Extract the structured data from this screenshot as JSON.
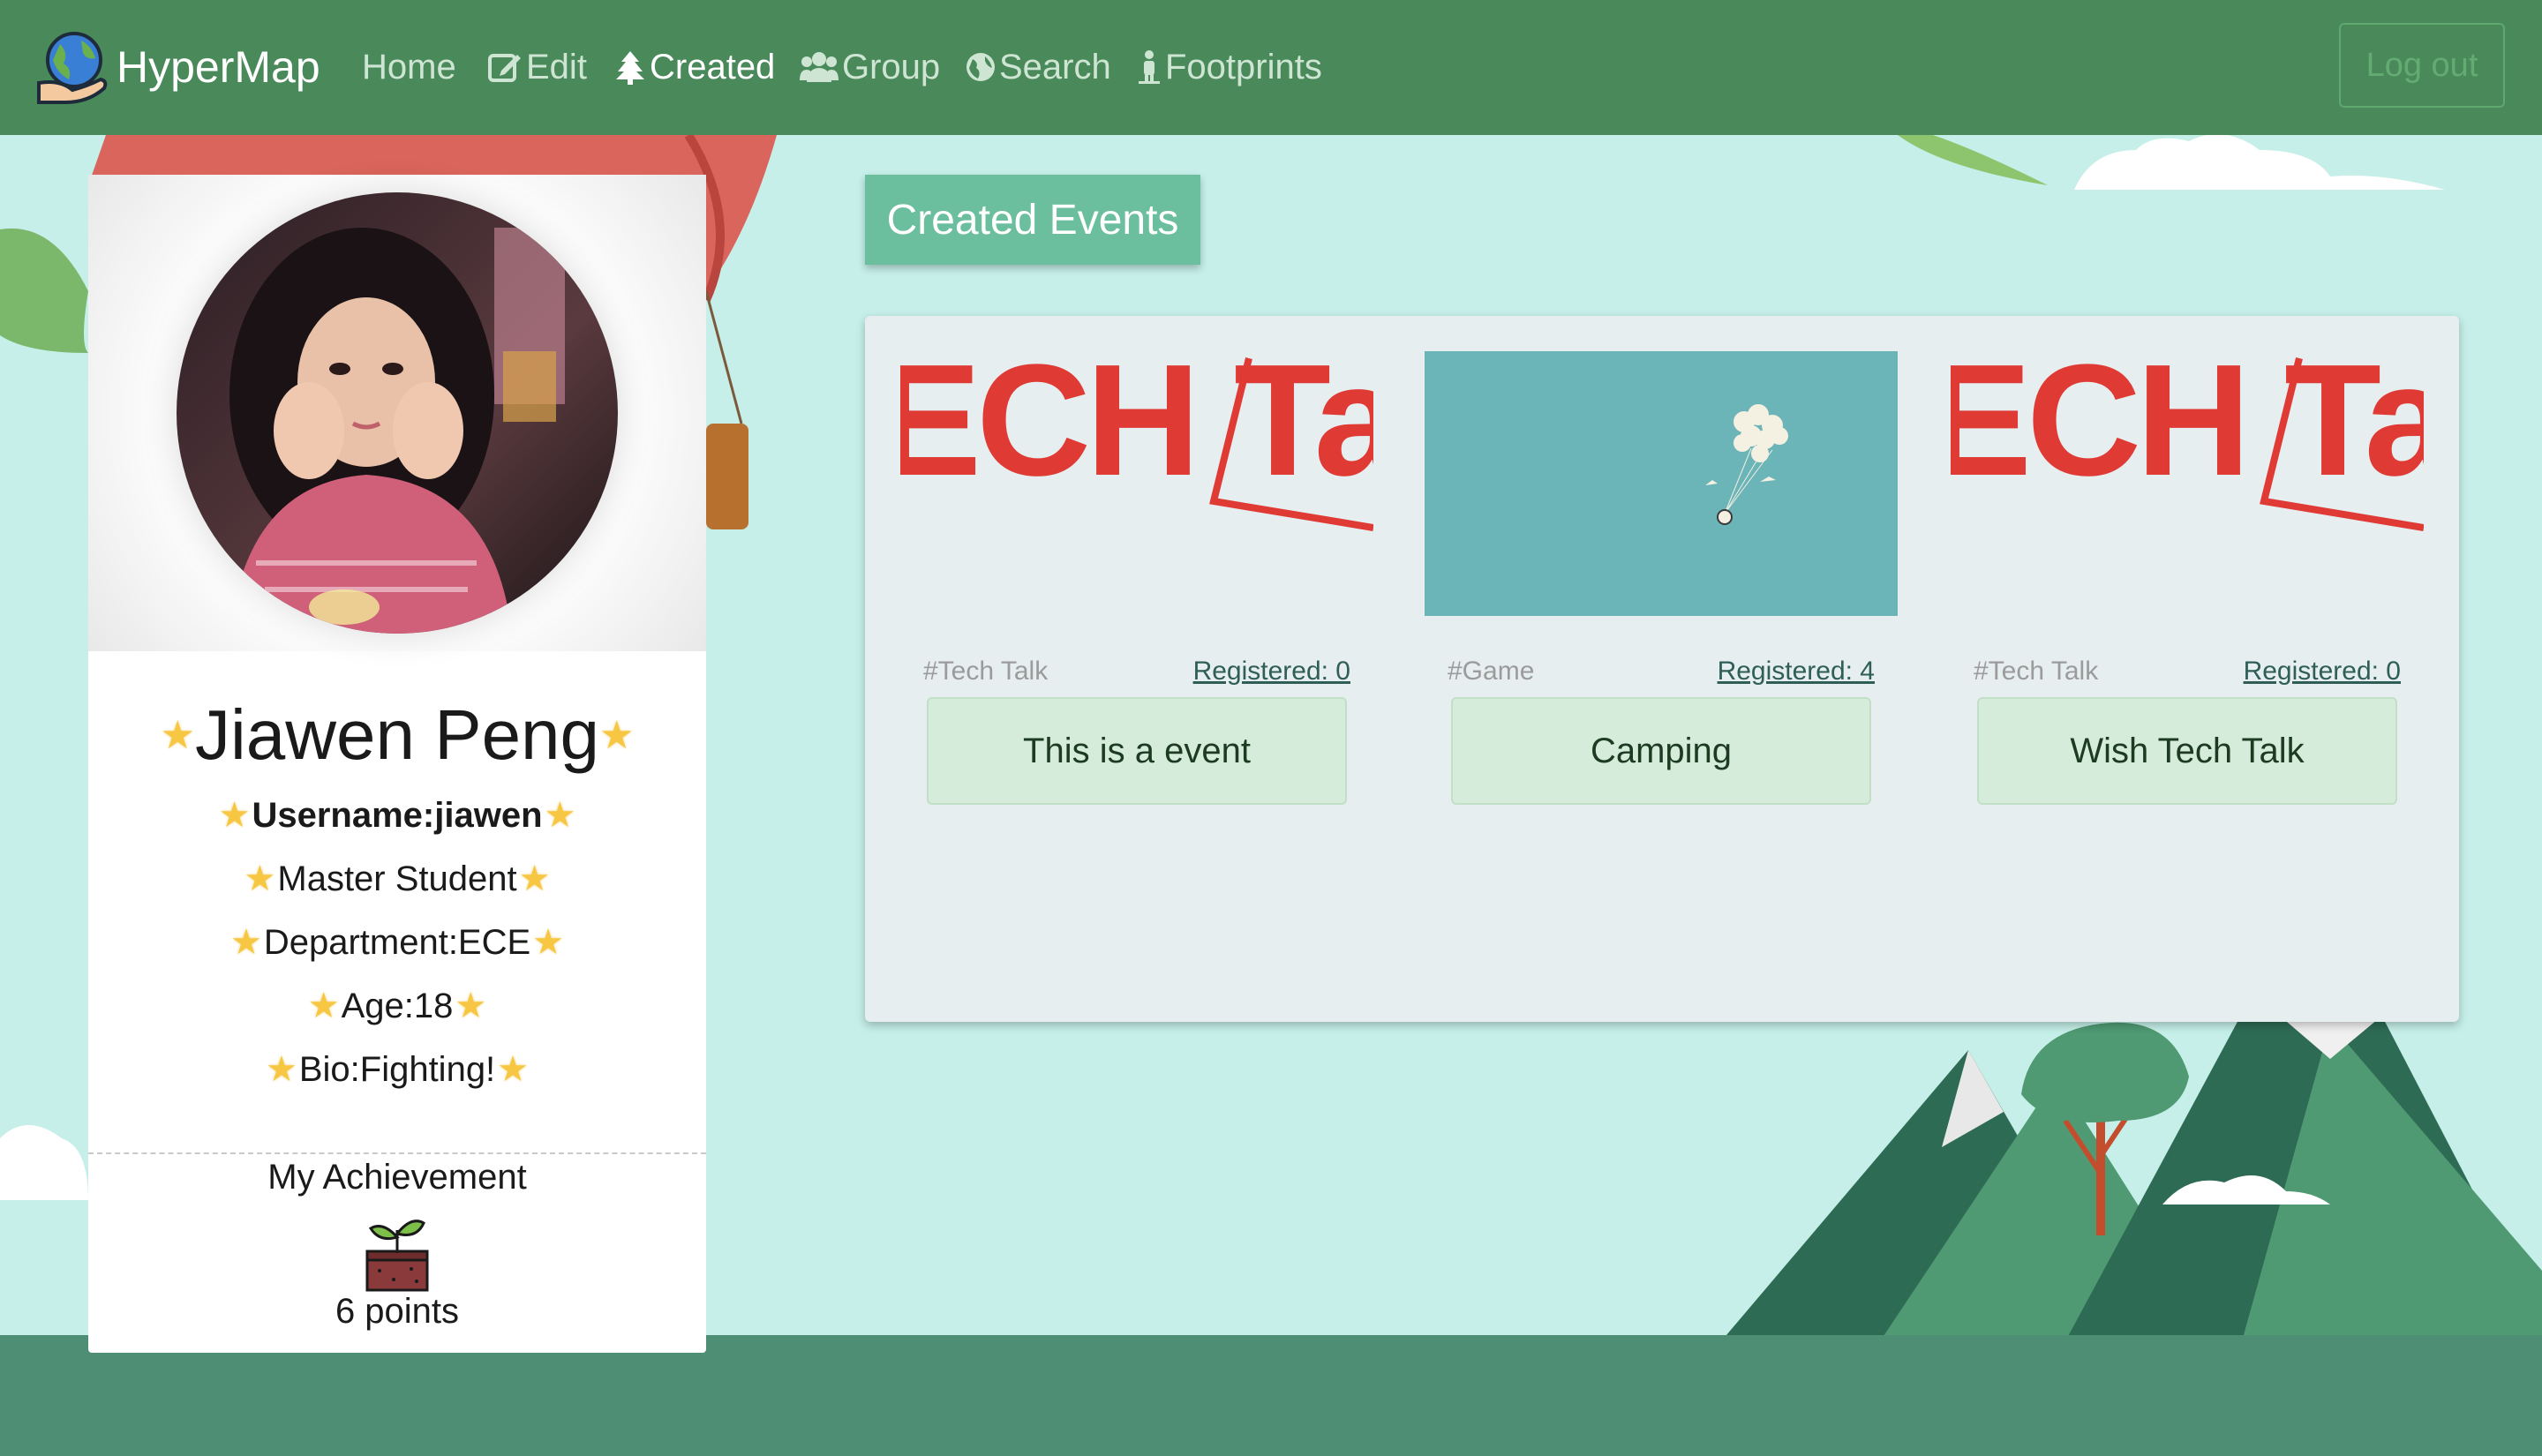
{
  "app": {
    "brand_name": "HyperMap",
    "logo_icon": "globe-hand-icon"
  },
  "nav": {
    "items": [
      {
        "label": "Home",
        "icon": "",
        "active": false
      },
      {
        "label": "Edit",
        "icon": "edit-icon",
        "active": false
      },
      {
        "label": "Created",
        "icon": "tree-icon",
        "active": true
      },
      {
        "label": "Group",
        "icon": "group-icon",
        "active": false
      },
      {
        "label": "Search",
        "icon": "globe-icon",
        "active": false
      },
      {
        "label": "Footprints",
        "icon": "person-icon",
        "active": false
      }
    ],
    "logout_label": "Log out"
  },
  "profile": {
    "name": "Jiawen Peng",
    "username": "Username:jiawen",
    "role": "Master Student",
    "department": "Department:ECE",
    "age": "Age:18",
    "bio": "Bio:Fighting!",
    "star_icon": "star-icon",
    "achievement_title": "My Achievement",
    "achievement_icon": "sprout-icon",
    "achievement_points": "6 points"
  },
  "events": {
    "title": "Created Events",
    "items": [
      {
        "tag": "#Tech Talk",
        "registered": "Registered: 0",
        "name": "This is a event",
        "image": "tech-talk-banner",
        "image_text": "ECH Ta"
      },
      {
        "tag": "#Game",
        "registered": "Registered: 4",
        "name": "Camping",
        "image": "balloon-illustration",
        "image_text": ""
      },
      {
        "tag": "#Tech Talk",
        "registered": "Registered: 0",
        "name": "Wish Tech Talk",
        "image": "tech-talk-banner",
        "image_text": "ECH Ta"
      }
    ]
  },
  "colors": {
    "navbar": "#4a8a5a",
    "background": "#c5efe8",
    "button_accent": "#6cbf9e",
    "event_button": "#d4ecd9",
    "banner_red": "#e03a35"
  }
}
